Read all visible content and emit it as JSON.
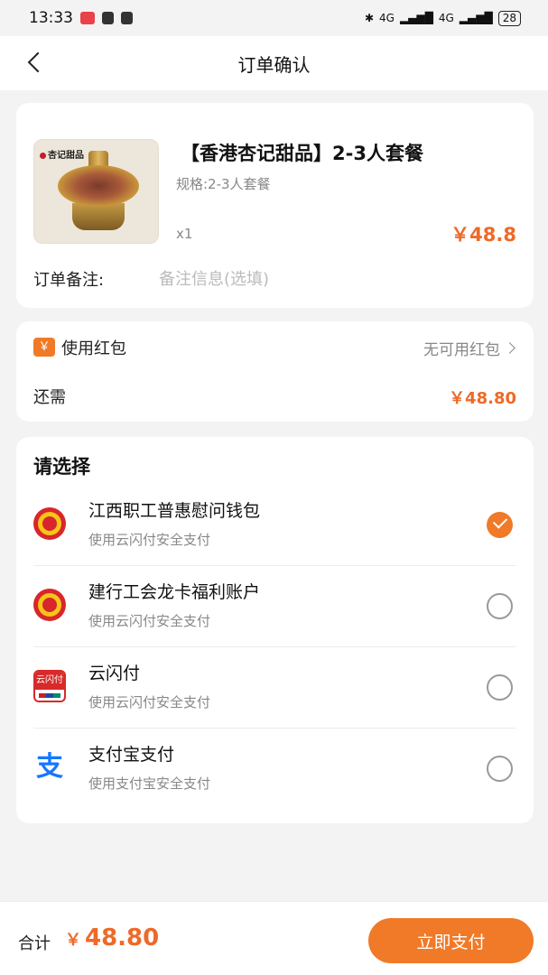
{
  "status_bar": {
    "time": "13:33",
    "network_1": "4G",
    "network_2": "4G",
    "battery": "28"
  },
  "nav": {
    "title": "订单确认"
  },
  "order": {
    "thumb_brand": "杏记甜品",
    "product_name": "【香港杏记甜品】2-3人套餐",
    "spec": "规格:2-3人套餐",
    "quantity": "x1",
    "price": "￥48.8",
    "remark_label": "订单备注:",
    "remark_placeholder": "备注信息(选填)",
    "remark_value": ""
  },
  "red_packet": {
    "badge": "￥",
    "label": "使用红包",
    "value": "无可用红包",
    "due_label": "还需",
    "due_value": "￥48.80"
  },
  "payment": {
    "title": "请选择",
    "methods": [
      {
        "name": "江西职工普惠慰问钱包",
        "desc": "使用云闪付安全支付",
        "logo": "union-badge-icon",
        "selected": true
      },
      {
        "name": "建行工会龙卡福利账户",
        "desc": "使用云闪付安全支付",
        "logo": "union-badge-icon",
        "selected": false
      },
      {
        "name": "云闪付",
        "desc": "使用云闪付安全支付",
        "logo": "unionpay-icon",
        "logo_text": "云闪付",
        "selected": false
      },
      {
        "name": "支付宝支付",
        "desc": "使用支付宝安全支付",
        "logo": "alipay-icon",
        "logo_text": "支",
        "selected": false
      }
    ]
  },
  "footer": {
    "total_label": "合计",
    "currency": "￥",
    "total_amount": "48.80",
    "pay_button": "立即支付"
  },
  "colors": {
    "accent": "#f07a28",
    "price": "#ee6a28",
    "background": "#f3f3f3"
  }
}
